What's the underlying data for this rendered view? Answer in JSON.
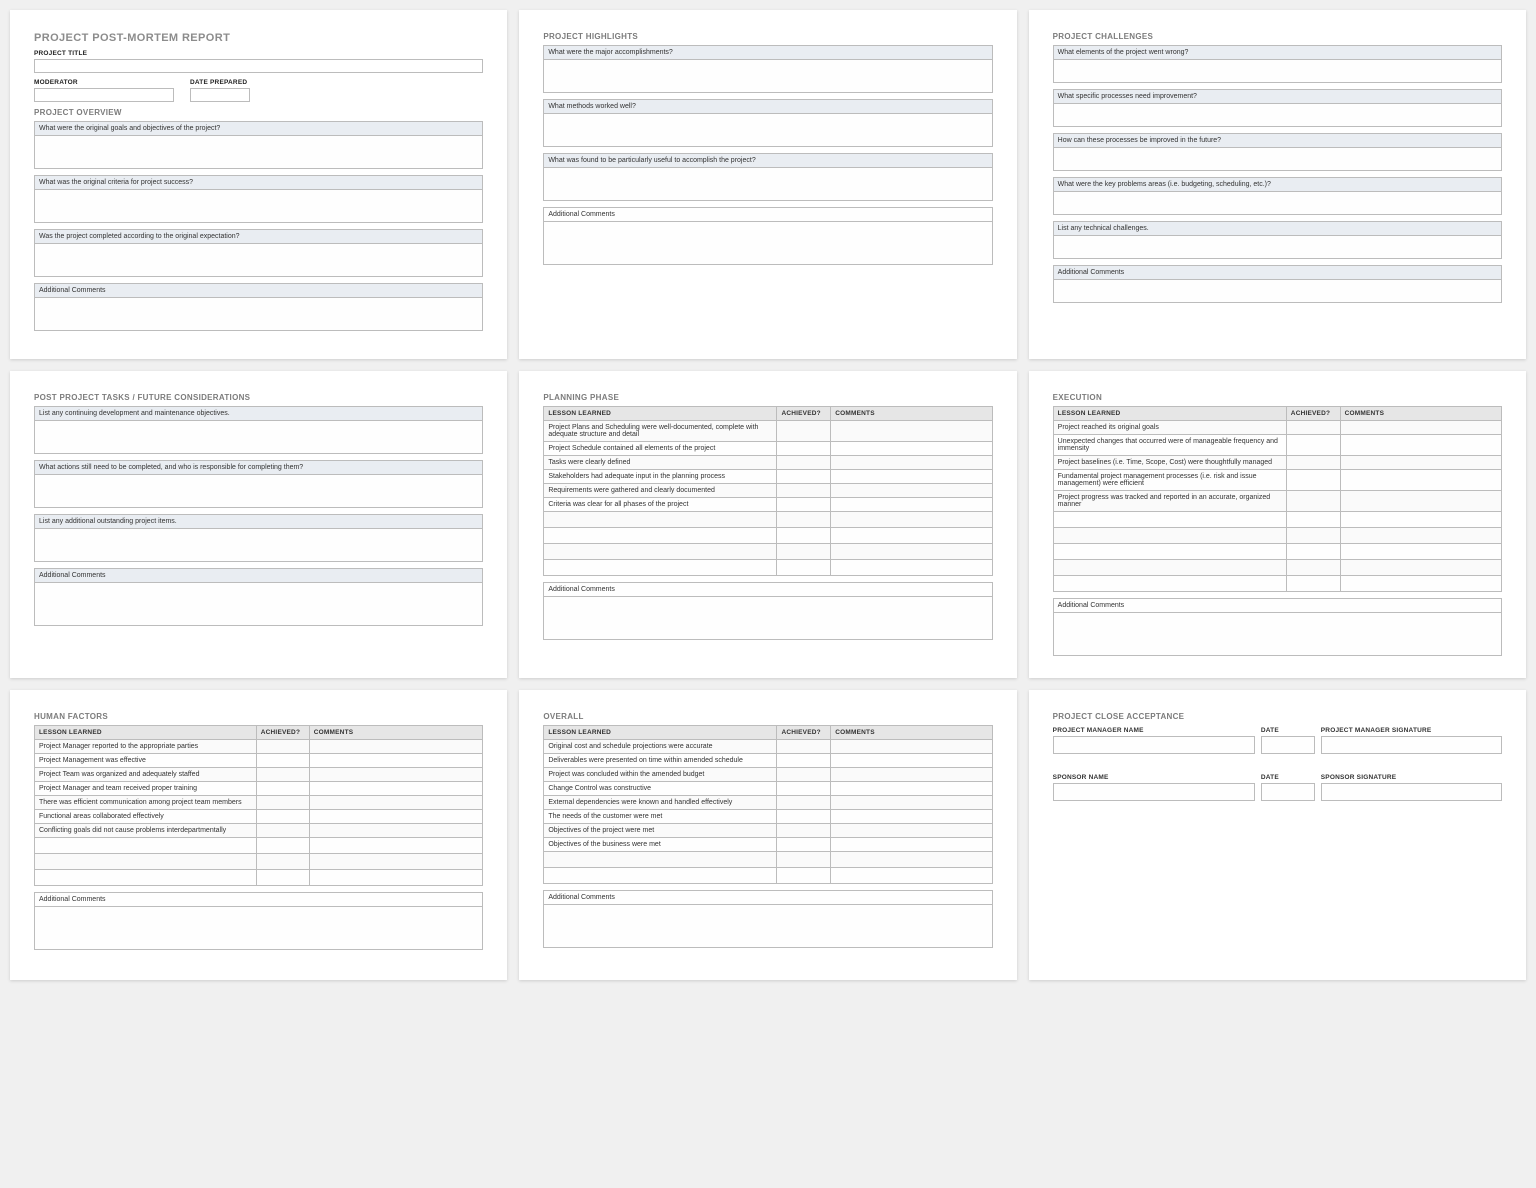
{
  "main": {
    "title": "PROJECT POST-MORTEM REPORT",
    "project_title_label": "PROJECT TITLE",
    "moderator_label": "MODERATOR",
    "date_prepared_label": "DATE PREPARED"
  },
  "overview": {
    "title": "PROJECT OVERVIEW",
    "q1": "What were the original goals and objectives of the project?",
    "q2": "What was the original criteria for project success?",
    "q3": "Was the project completed according to the original expectation?",
    "addl": "Additional Comments"
  },
  "highlights": {
    "title": "PROJECT HIGHLIGHTS",
    "q1": "What were the major accomplishments?",
    "q2": "What methods worked well?",
    "q3": "What was found to be particularly useful to accomplish the project?",
    "addl": "Additional Comments"
  },
  "challenges": {
    "title": "PROJECT CHALLENGES",
    "q1": "What elements of the project went wrong?",
    "q2": "What specific processes need improvement?",
    "q3": "How can these processes be improved in the future?",
    "q4": "What were the key problems areas (i.e. budgeting, scheduling, etc.)?",
    "q5": "List any technical challenges.",
    "addl": "Additional Comments"
  },
  "postproject": {
    "title": "POST PROJECT TASKS / FUTURE CONSIDERATIONS",
    "q1": "List any continuing development and maintenance objectives.",
    "q2": "What actions still need to be completed, and who is responsible for completing them?",
    "q3": "List any additional outstanding project items.",
    "addl": "Additional Comments"
  },
  "tbl_headers": {
    "lesson": "LESSON LEARNED",
    "achieved": "ACHIEVED?",
    "comments": "COMMENTS"
  },
  "planning": {
    "title": "PLANNING PHASE",
    "rows": [
      "Project Plans and Scheduling were well-documented, complete with adequate structure and detail",
      "Project Schedule contained all elements of the project",
      "Tasks were clearly defined",
      "Stakeholders had adequate input in the planning process",
      "Requirements were gathered and clearly documented",
      "Criteria was clear for all phases of the project"
    ],
    "addl": "Additional Comments"
  },
  "execution": {
    "title": "EXECUTION",
    "rows": [
      "Project reached its original goals",
      "Unexpected changes that occurred were of manageable frequency and immensity",
      "Project baselines (i.e. Time, Scope, Cost) were thoughtfully managed",
      "Fundamental project management processes (i.e. risk and issue management) were efficient",
      "Project progress was tracked and reported in an accurate, organized manner"
    ],
    "addl": "Additional Comments"
  },
  "human": {
    "title": "HUMAN FACTORS",
    "rows": [
      "Project Manager reported to the appropriate parties",
      "Project Management was effective",
      "Project Team was organized and adequately staffed",
      "Project Manager and team received proper training",
      "There was efficient communication among project team members",
      "Functional areas collaborated effectively",
      "Conflicting goals did not cause problems interdepartmentally"
    ],
    "addl": "Additional Comments"
  },
  "overall": {
    "title": "OVERALL",
    "rows": [
      "Original cost and schedule projections were accurate",
      "Deliverables were presented on time within amended schedule",
      "Project was concluded within the amended budget",
      "Change Control was constructive",
      "External dependencies were known and handled effectively",
      "The needs of the customer were met",
      "Objectives of the project were met",
      "Objectives of the business were met"
    ],
    "addl": "Additional Comments"
  },
  "close": {
    "title": "PROJECT CLOSE ACCEPTANCE",
    "pm_name": "PROJECT MANAGER NAME",
    "date": "DATE",
    "pm_sig": "PROJECT MANAGER SIGNATURE",
    "sponsor_name": "SPONSOR NAME",
    "sponsor_sig": "SPONSOR SIGNATURE"
  }
}
